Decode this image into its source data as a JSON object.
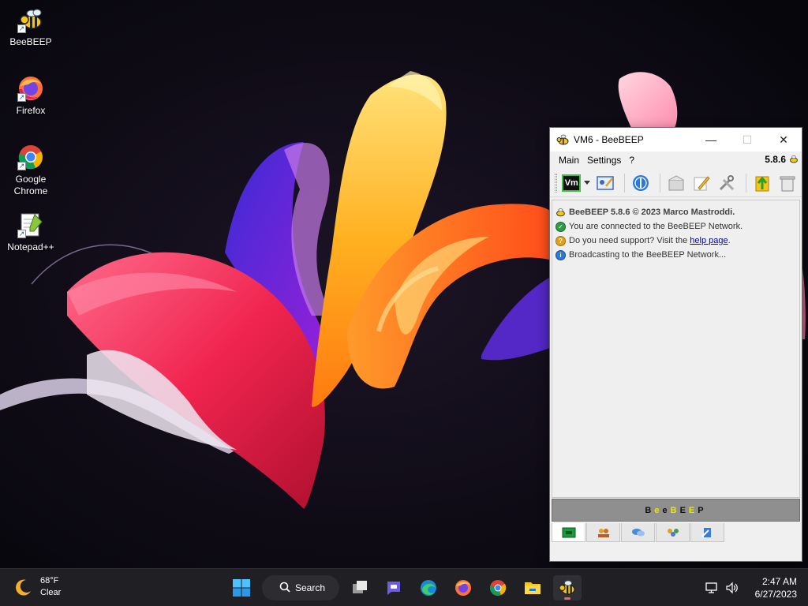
{
  "desktop": {
    "icons": [
      {
        "label": "BeeBEEP"
      },
      {
        "label": "Firefox"
      },
      {
        "label": "Google Chrome"
      },
      {
        "label": "Notepad++"
      }
    ]
  },
  "window": {
    "title": "VM6 - BeeBEEP",
    "menu": {
      "main": "Main",
      "settings": "Settings",
      "help": "?"
    },
    "version": "5.8.6",
    "toolbar": {
      "status_button": "Vm"
    },
    "chat": {
      "lines": [
        "BeeBEEP 5.8.6 © 2023 Marco Mastroddi.",
        "You are connected to the BeeBEEP Network.",
        "Do you need support? Visit the",
        "Broadcasting to the BeeBEEP Network..."
      ],
      "help_link": "help page",
      "help_suffix": "."
    },
    "brand": {
      "b1": "B",
      "e1": "e",
      "e2": "e",
      "b2": "B",
      "e3": "E",
      "e4": "E",
      "p": "P"
    }
  },
  "taskbar": {
    "weather_temp": "68°F",
    "weather_cond": "Clear",
    "search_label": "Search",
    "time": "2:47 AM",
    "date": "6/27/2023"
  },
  "colors": {
    "accent": "#0067c0",
    "bee_yellow": "#f5c518"
  }
}
